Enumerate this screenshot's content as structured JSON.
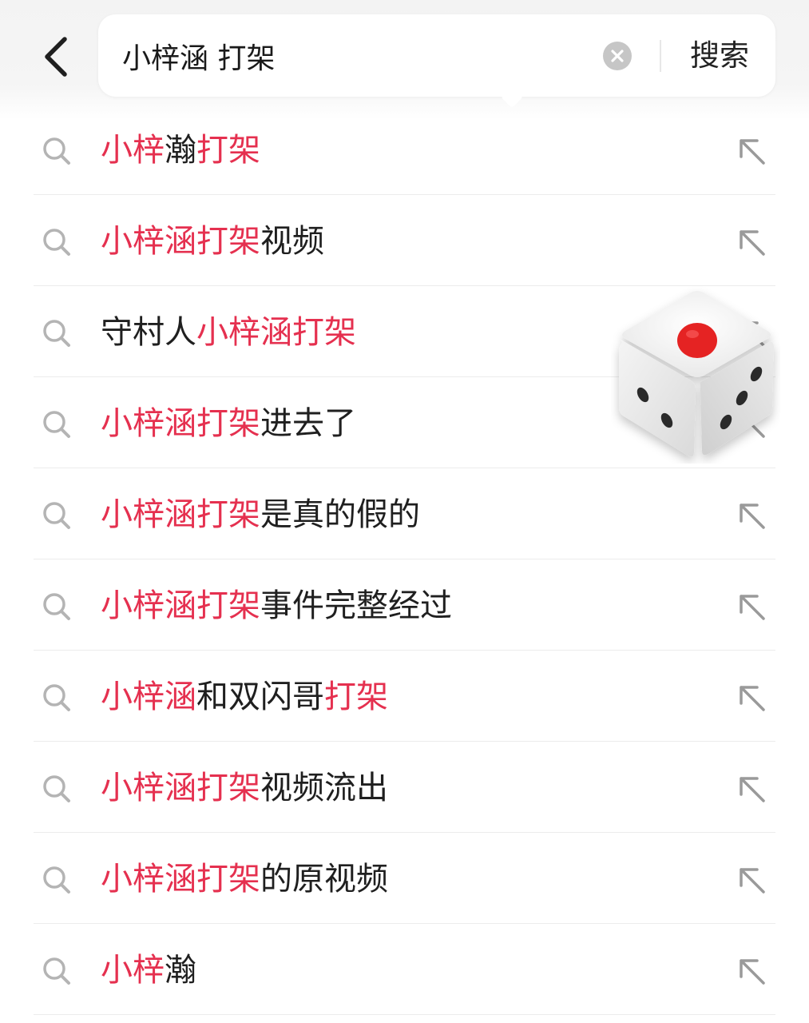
{
  "header": {
    "back_icon": "chevron-left-icon",
    "search": {
      "value": "小梓涵 打架",
      "clear_icon": "close-circle-icon",
      "button_label": "搜索"
    }
  },
  "colors": {
    "highlight": "#e5304f",
    "text": "#1f1f1f",
    "icon": "#b4b4b4",
    "die_pip": "#e52323"
  },
  "suggestions": [
    {
      "segments": [
        {
          "t": "小梓",
          "h": true
        },
        {
          "t": "瀚",
          "h": false
        },
        {
          "t": "打架",
          "h": true
        }
      ]
    },
    {
      "segments": [
        {
          "t": "小梓涵打架",
          "h": true
        },
        {
          "t": "视频",
          "h": false
        }
      ]
    },
    {
      "segments": [
        {
          "t": "守村人",
          "h": false
        },
        {
          "t": "小梓涵打架",
          "h": true
        }
      ]
    },
    {
      "segments": [
        {
          "t": "小梓涵打架",
          "h": true
        },
        {
          "t": "进去了",
          "h": false
        }
      ]
    },
    {
      "segments": [
        {
          "t": "小梓涵打架",
          "h": true
        },
        {
          "t": "是真的假的",
          "h": false
        }
      ]
    },
    {
      "segments": [
        {
          "t": "小梓涵打架",
          "h": true
        },
        {
          "t": "事件完整经过",
          "h": false
        }
      ]
    },
    {
      "segments": [
        {
          "t": "小梓涵",
          "h": true
        },
        {
          "t": "和双闪哥",
          "h": false
        },
        {
          "t": "打架",
          "h": true
        }
      ]
    },
    {
      "segments": [
        {
          "t": "小梓涵打架",
          "h": true
        },
        {
          "t": "视频流出",
          "h": false
        }
      ]
    },
    {
      "segments": [
        {
          "t": "小梓涵打架",
          "h": true
        },
        {
          "t": "的原视频",
          "h": false
        }
      ]
    },
    {
      "segments": [
        {
          "t": "小梓",
          "h": true
        },
        {
          "t": "瀚",
          "h": false
        }
      ]
    }
  ],
  "row_icons": {
    "left": "search-icon",
    "right": "arrow-up-left-icon"
  },
  "overlay": {
    "icon": "dice-icon"
  }
}
